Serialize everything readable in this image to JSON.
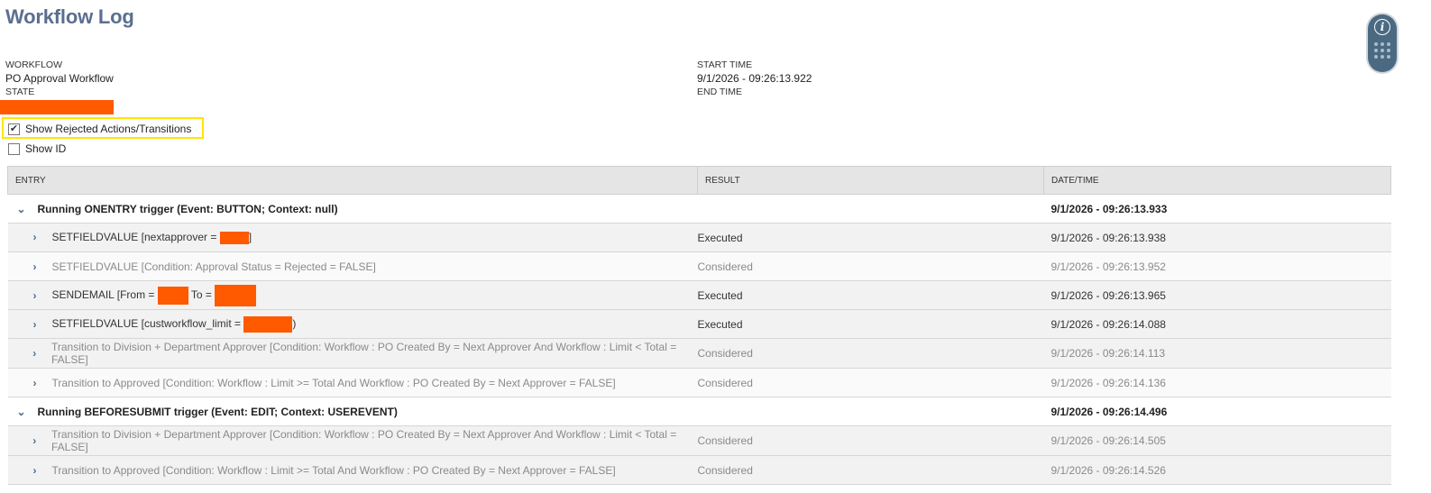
{
  "page": {
    "title": "Workflow Log"
  },
  "info": {
    "workflow_label": "WORKFLOW",
    "workflow_value": "PO Approval Workflow",
    "state_label": "STATE",
    "start_time_label": "START TIME",
    "start_time_value": "9/1/2026 - 09:26:13.922",
    "end_time_label": "END TIME"
  },
  "options": {
    "show_rejected_label": "Show Rejected Actions/Transitions",
    "show_rejected_checked": true,
    "show_id_label": "Show ID",
    "show_id_checked": false,
    "check_glyph": "✔"
  },
  "table": {
    "headers": {
      "entry": "ENTRY",
      "result": "RESULT",
      "datetime": "DATE/TIME"
    },
    "rows": [
      {
        "type": "group",
        "entry": "Running ONENTRY trigger (Event: BUTTON; Context: null)",
        "result": "",
        "datetime": "9/1/2026 - 09:26:13.933"
      },
      {
        "type": "detail",
        "entry_prefix": "SETFIELDVALUE [nextapprover = ",
        "entry_suffix": "]",
        "result": "Executed",
        "datetime": "9/1/2026 - 09:26:13.938"
      },
      {
        "type": "detail",
        "entry": "SETFIELDVALUE [Condition: Approval Status = Rejected = FALSE]",
        "result": "Considered",
        "datetime": "9/1/2026 - 09:26:13.952"
      },
      {
        "type": "detail",
        "entry_prefix": "SENDEMAIL [From = ",
        "entry_middle": " To = ",
        "result": "Executed",
        "datetime": "9/1/2026 - 09:26:13.965"
      },
      {
        "type": "detail",
        "entry_prefix": "SETFIELDVALUE [custworkflow_limit = ",
        "entry_suffix": ")",
        "result": "Executed",
        "datetime": "9/1/2026 - 09:26:14.088"
      },
      {
        "type": "detail",
        "entry": "Transition to Division + Department Approver [Condition: Workflow : PO Created By = Next Approver And Workflow : Limit < Total = FALSE]",
        "result": "Considered",
        "datetime": "9/1/2026 - 09:26:14.113"
      },
      {
        "type": "detail",
        "entry": "Transition to Approved [Condition: Workflow : Limit >= Total And Workflow : PO Created By = Next Approver = FALSE]",
        "result": "Considered",
        "datetime": "9/1/2026 - 09:26:14.136"
      },
      {
        "type": "group",
        "entry": "Running BEFORESUBMIT trigger (Event: EDIT; Context: USEREVENT)",
        "result": "",
        "datetime": "9/1/2026 - 09:26:14.496"
      },
      {
        "type": "detail",
        "entry": "Transition to Division + Department Approver [Condition: Workflow : PO Created By = Next Approver And Workflow : Limit < Total = FALSE]",
        "result": "Considered",
        "datetime": "9/1/2026 - 09:26:14.505"
      },
      {
        "type": "detail",
        "entry": "Transition to Approved [Condition: Workflow : Limit >= Total And Workflow : PO Created By = Next Approver = FALSE]",
        "result": "Considered",
        "datetime": "9/1/2026 - 09:26:14.526"
      }
    ]
  },
  "icons": {
    "expanded": "⌄",
    "collapsed": "›",
    "info": "i"
  },
  "colors": {
    "title": "#5a6f8f",
    "redaction": "#ff5a00",
    "highlight": "#ffe500",
    "widget": "#4b6a82"
  }
}
